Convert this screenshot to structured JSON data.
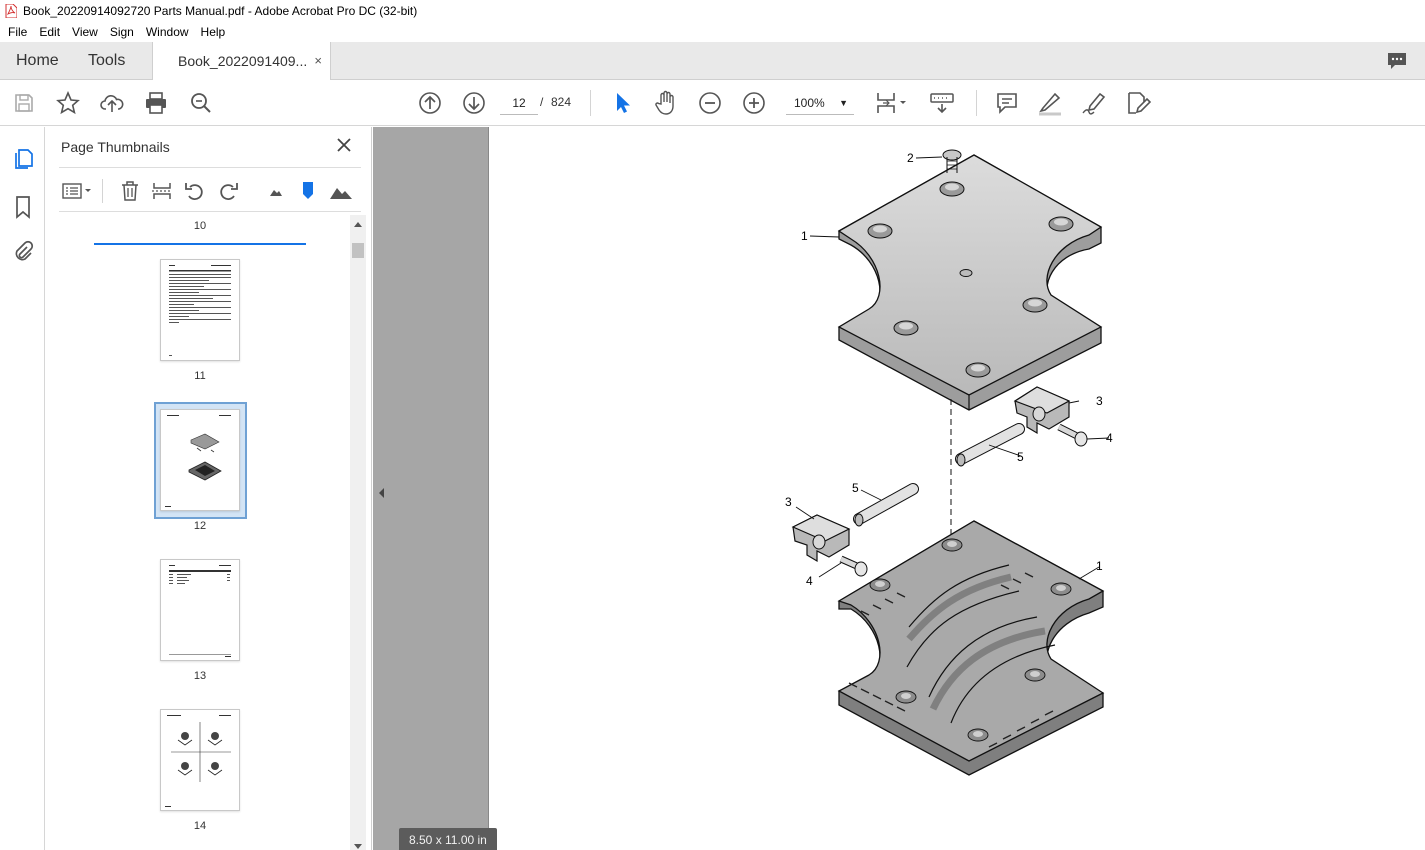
{
  "window": {
    "title": "Book_20220914092720 Parts Manual.pdf - Adobe Acrobat Pro DC (32-bit)"
  },
  "menu": [
    "File",
    "Edit",
    "View",
    "Sign",
    "Window",
    "Help"
  ],
  "tabs": {
    "home": "Home",
    "tools": "Tools",
    "document": "Book_2022091409...",
    "close": "×"
  },
  "toolbar": {
    "current_page": "12",
    "page_separator": "/",
    "page_total": "824",
    "zoom": "100%",
    "zoom_caret": "▼"
  },
  "panel": {
    "title": "Page Thumbnails",
    "thumbnails": [
      {
        "label": "10"
      },
      {
        "label": "11"
      },
      {
        "label": "12",
        "selected": true
      },
      {
        "label": "13"
      },
      {
        "label": "14"
      }
    ]
  },
  "document": {
    "page_size": "8.50 x 11.00 in",
    "callouts": [
      "1",
      "2",
      "3",
      "4",
      "5",
      "5",
      "3",
      "4",
      "1"
    ]
  },
  "colors": {
    "accent": "#1473e6",
    "selection": "#6fa1d4",
    "part_fill": "#c8c8c8"
  }
}
